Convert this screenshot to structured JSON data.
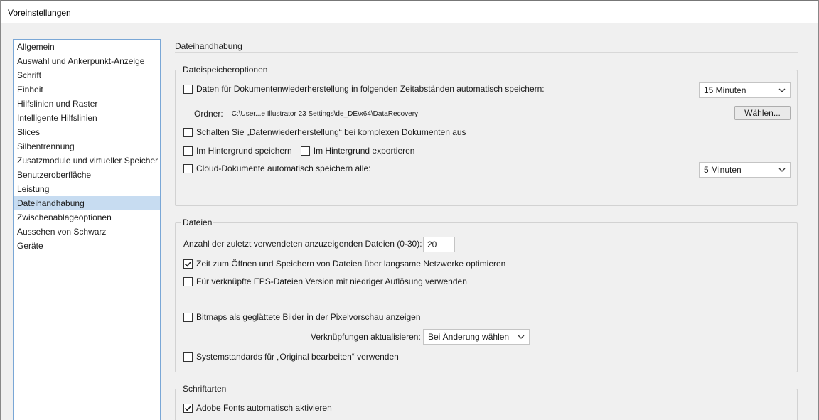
{
  "window": {
    "title": "Voreinstellungen"
  },
  "sidebar": {
    "items": [
      {
        "label": "Allgemein"
      },
      {
        "label": "Auswahl und Ankerpunkt-Anzeige"
      },
      {
        "label": "Schrift"
      },
      {
        "label": "Einheit"
      },
      {
        "label": "Hilfslinien und Raster"
      },
      {
        "label": "Intelligente Hilfslinien"
      },
      {
        "label": "Slices"
      },
      {
        "label": "Silbentrennung"
      },
      {
        "label": "Zusatzmodule und virtueller Speicher"
      },
      {
        "label": "Benutzeroberfläche"
      },
      {
        "label": "Leistung"
      },
      {
        "label": "Dateihandhabung"
      },
      {
        "label": "Zwischenablageoptionen"
      },
      {
        "label": "Aussehen von Schwarz"
      },
      {
        "label": "Geräte"
      }
    ],
    "selected": "Dateihandhabung"
  },
  "main": {
    "title": "Dateihandhabung",
    "save_options": {
      "legend": "Dateispeicheroptionen",
      "autosave_label": "Daten für Dokumentenwiederherstellung in folgenden Zeitabständen automatisch speichern:",
      "autosave_checked": false,
      "autosave_interval": "15 Minuten",
      "folder_label": "Ordner:",
      "folder_path": "C:\\User...e Illustrator 23 Settings\\de_DE\\x64\\DataRecovery",
      "choose_button": "Wählen...",
      "complex_docs_label": "Schalten Sie „Datenwiederherstellung“ bei komplexen Dokumenten aus",
      "complex_docs_checked": false,
      "bg_save_label": "Im Hintergrund speichern",
      "bg_save_checked": false,
      "bg_export_label": "Im Hintergrund exportieren",
      "bg_export_checked": false,
      "cloud_label": "Cloud-Dokumente automatisch speichern alle:",
      "cloud_checked": false,
      "cloud_interval": "5 Minuten"
    },
    "files": {
      "legend": "Dateien",
      "recent_label": "Anzahl der zuletzt verwendeten anzuzeigenden Dateien (0-30):",
      "recent_value": "20",
      "optimize_label": "Zeit zum Öffnen und Speichern von Dateien über langsame Netzwerke optimieren",
      "optimize_checked": true,
      "eps_label": "Für verknüpfte EPS-Dateien Version mit niedriger Auflösung verwenden",
      "eps_checked": false,
      "bitmaps_label": "Bitmaps als geglättete Bilder in der Pixelvorschau anzeigen",
      "bitmaps_checked": false,
      "update_links_label": "Verknüpfungen aktualisieren:",
      "update_links_value": "Bei Änderung wählen",
      "system_defaults_label": "Systemstandards für „Original bearbeiten“ verwenden",
      "system_defaults_checked": false
    },
    "fonts": {
      "legend": "Schriftarten",
      "adobe_fonts_label": "Adobe Fonts automatisch aktivieren",
      "adobe_fonts_checked": true
    }
  },
  "icons": {
    "checkbox": "checkbox-icon",
    "checkmark": "checkmark-icon",
    "dropdown": "chevron-down-icon"
  }
}
